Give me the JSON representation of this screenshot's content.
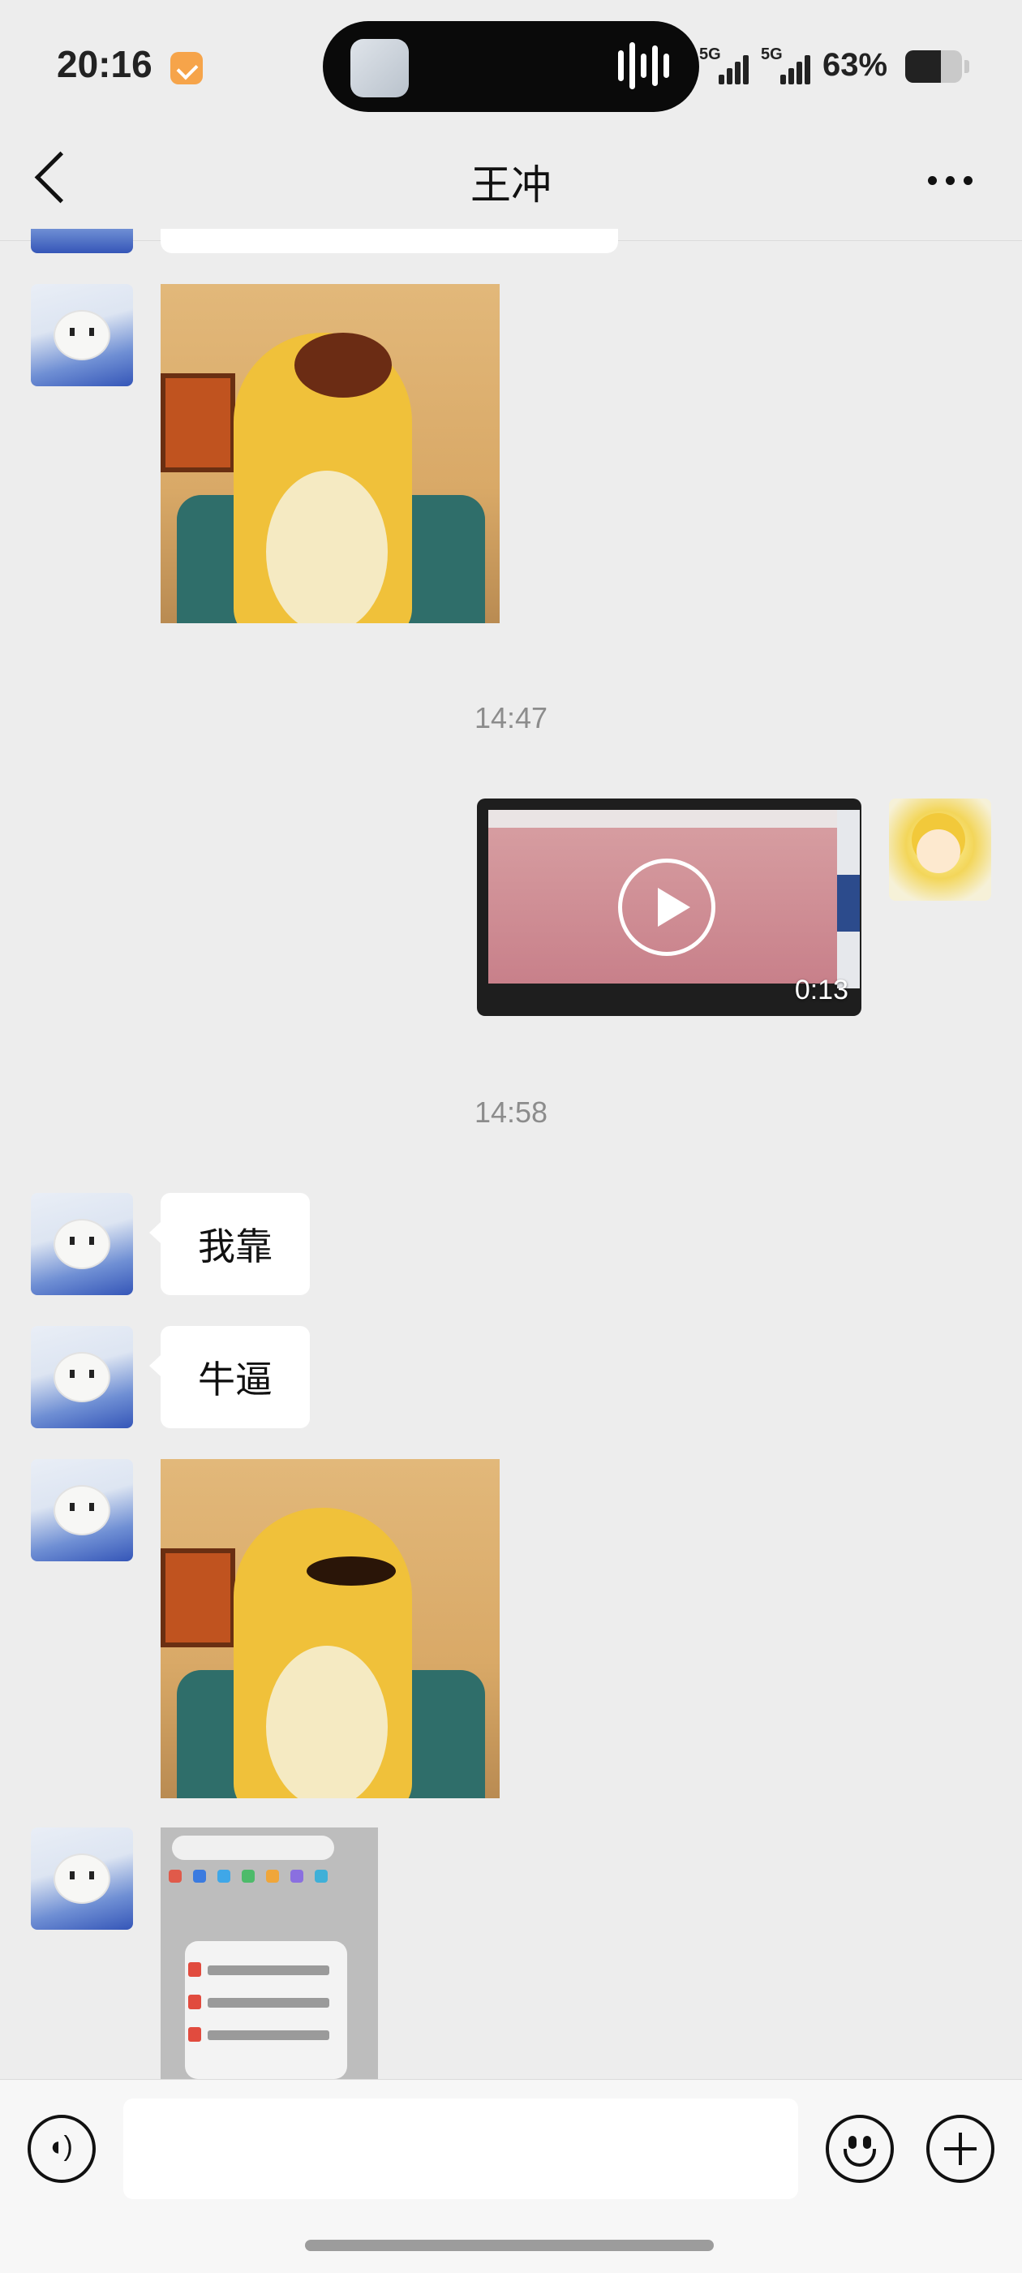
{
  "status_bar": {
    "time": "20:16",
    "app_badge_icon": "app-notification-icon",
    "network_1": "5G",
    "network_2": "5G",
    "battery_percent": "63%",
    "battery_level": 0.63
  },
  "nav": {
    "title": "王冲",
    "back_icon": "chevron-left-icon",
    "more_icon": "more-dots-icon"
  },
  "messages": [
    {
      "type": "image",
      "sender": "contact",
      "content": "sticker"
    },
    {
      "type": "timestamp",
      "text": "14:47"
    },
    {
      "type": "video",
      "sender": "self",
      "duration": "0:13"
    },
    {
      "type": "timestamp",
      "text": "14:58"
    },
    {
      "type": "text",
      "sender": "contact",
      "text": "我靠"
    },
    {
      "type": "text",
      "sender": "contact",
      "text": "牛逼"
    },
    {
      "type": "image",
      "sender": "contact",
      "content": "sticker"
    },
    {
      "type": "image",
      "sender": "contact",
      "content": "screenshot"
    }
  ],
  "input_bar": {
    "voice_icon": "voice-input-icon",
    "input_value": "",
    "emoji_icon": "emoji-icon",
    "plus_icon": "plus-icon"
  }
}
